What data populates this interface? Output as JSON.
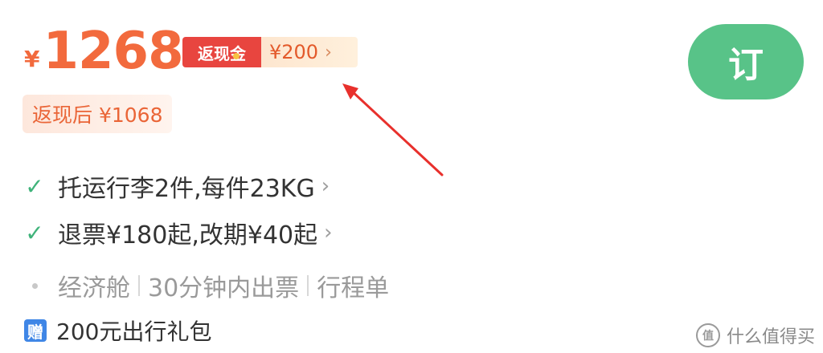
{
  "price": {
    "currency": "¥",
    "amount": "1268"
  },
  "cashback": {
    "badge_label": "返现金",
    "amount": "¥200",
    "chevron": "›"
  },
  "after_cashback": {
    "label": "返现后 ¥1068"
  },
  "features": [
    {
      "icon": "check-icon",
      "text": "托运行李2件,每件23KG",
      "chevron": "›"
    },
    {
      "icon": "check-icon",
      "text": "退票¥180起,改期¥40起",
      "chevron": "›"
    }
  ],
  "ticket_info": {
    "items": [
      "经济舱",
      "30分钟内出票",
      "行程单"
    ]
  },
  "gift": {
    "icon_label": "赠",
    "text": "200元出行礼包"
  },
  "book_button": {
    "label": "订"
  },
  "watermark": {
    "icon_label": "值",
    "text": "什么值得买"
  },
  "colors": {
    "price": "#f26a3d",
    "cashback_badge": "#e8453f",
    "book_button": "#58c388",
    "check": "#3fb37a",
    "annotation_arrow": "#e8302c",
    "gift_icon": "#3f86e6"
  }
}
